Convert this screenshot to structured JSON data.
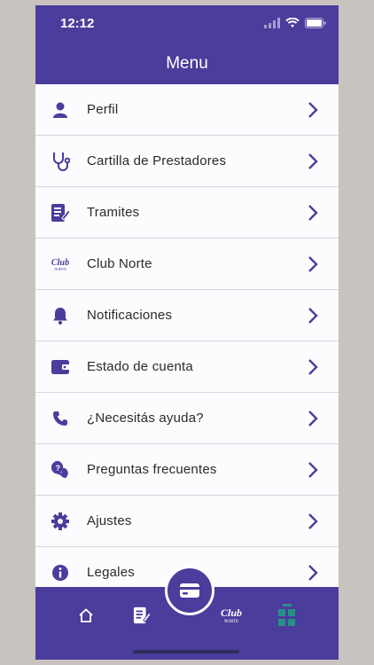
{
  "status": {
    "time": "12:12"
  },
  "header": {
    "title": "Menu"
  },
  "menu": {
    "items": [
      {
        "label": "Perfil",
        "icon": "person-icon"
      },
      {
        "label": "Cartilla de Prestadores",
        "icon": "stethoscope-icon"
      },
      {
        "label": "Tramites",
        "icon": "document-edit-icon"
      },
      {
        "label": "Club Norte",
        "icon": "club-norte-logo"
      },
      {
        "label": "Notificaciones",
        "icon": "bell-icon"
      },
      {
        "label": "Estado de cuenta",
        "icon": "wallet-icon"
      },
      {
        "label": "¿Necesitás ayuda?",
        "icon": "phone-icon"
      },
      {
        "label": "Preguntas frecuentes",
        "icon": "question-chat-icon"
      },
      {
        "label": "Ajustes",
        "icon": "gear-icon"
      },
      {
        "label": "Legales",
        "icon": "info-icon"
      }
    ]
  },
  "bottom_nav": {
    "logo_text": "Club",
    "logo_sub": "NORTE",
    "items": [
      "home-icon",
      "document-edit-icon",
      "credential-card-icon",
      "club-norte-logo",
      "grid-menu-icon"
    ],
    "active": "grid-menu-icon"
  },
  "colors": {
    "primary": "#4a3d9c",
    "active_tab": "#2a8f8a",
    "background": "#faf8fa"
  }
}
